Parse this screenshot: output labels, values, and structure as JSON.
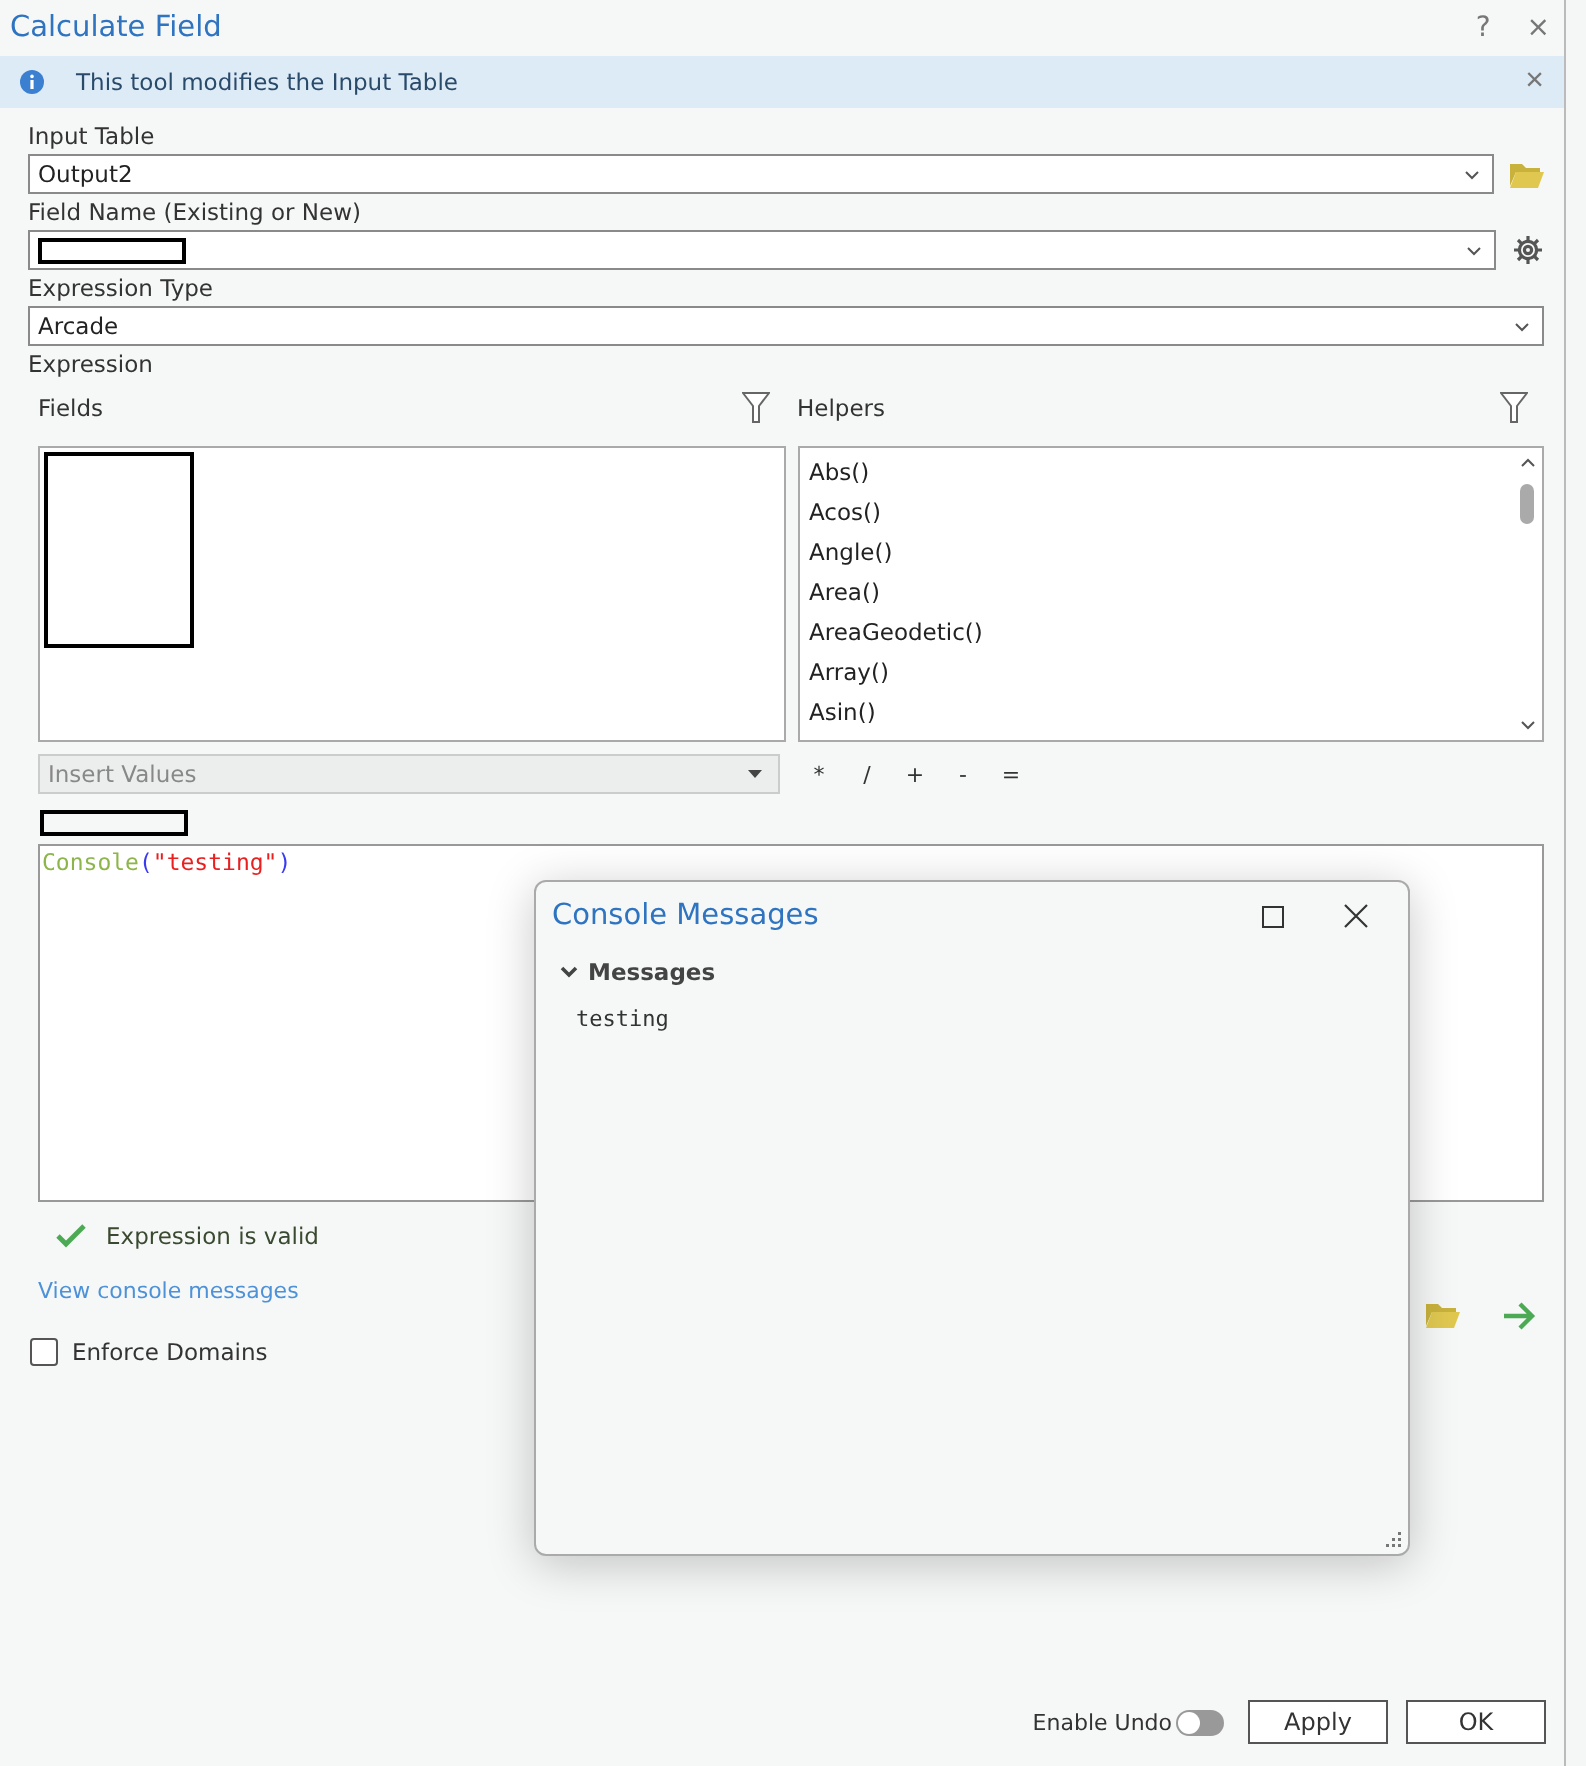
{
  "window": {
    "title": "Calculate Field",
    "help": "?",
    "close": "×"
  },
  "info_bar": {
    "text": "This tool modifies the Input Table",
    "dismiss": "×"
  },
  "input_table": {
    "label": "Input Table",
    "value": "Output2"
  },
  "field_name": {
    "label": "Field Name (Existing or New)",
    "redacted": true
  },
  "expression_type": {
    "label": "Expression Type",
    "value": "Arcade"
  },
  "expression": {
    "label": "Expression",
    "fields": {
      "label": "Fields",
      "redacted": true
    },
    "helpers": {
      "label": "Helpers",
      "items": [
        "Abs()",
        "Acos()",
        "Angle()",
        "Area()",
        "AreaGeodetic()",
        "Array()",
        "Asin()"
      ]
    },
    "insert_values": {
      "placeholder": "Insert Values",
      "disabled": true
    },
    "operators": [
      "*",
      "/",
      "+",
      "-",
      "="
    ],
    "code_label_redacted": true,
    "code": [
      {
        "kind": "function",
        "text": "Console"
      },
      {
        "kind": "paren",
        "text": "("
      },
      {
        "kind": "string",
        "text": "\"testing\""
      },
      {
        "kind": "paren",
        "text": ")"
      }
    ],
    "valid": true,
    "status": "Expression is valid",
    "console_link": "View console messages"
  },
  "enforce_domains": {
    "label": "Enforce Domains",
    "checked": false
  },
  "enable_undo": {
    "label": "Enable Undo",
    "on": false
  },
  "buttons": [
    "Apply",
    "OK"
  ],
  "console_popup": {
    "title": "Console Messages",
    "section": {
      "label": "Messages",
      "expanded": true,
      "messages": [
        "testing"
      ]
    }
  }
}
